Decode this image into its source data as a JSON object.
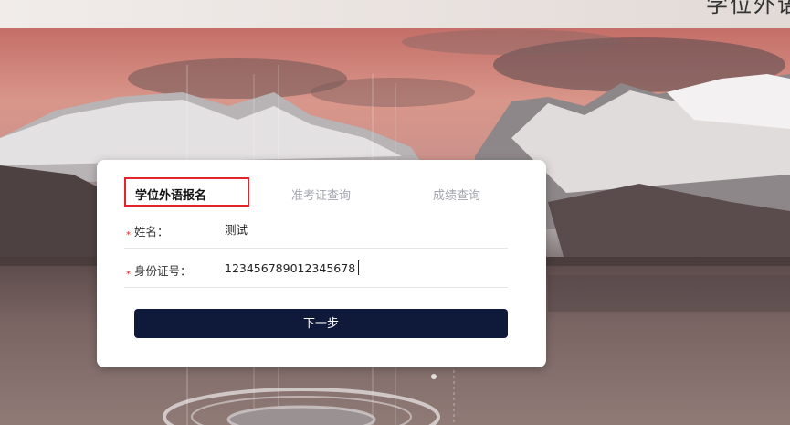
{
  "header": {
    "title": "学位外语"
  },
  "tabs": [
    {
      "label": "学位外语报名",
      "active": true
    },
    {
      "label": "准考证查询",
      "active": false
    },
    {
      "label": "成绩查询",
      "active": false
    }
  ],
  "form": {
    "name": {
      "label": "姓名：",
      "value": "测试"
    },
    "id_number": {
      "label": "身份证号：",
      "value": "123456789012345678"
    },
    "required_mark": "*",
    "next_button": "下一步"
  },
  "colors": {
    "accent_red": "#e0262a",
    "button_navy": "#0f1a3a"
  }
}
